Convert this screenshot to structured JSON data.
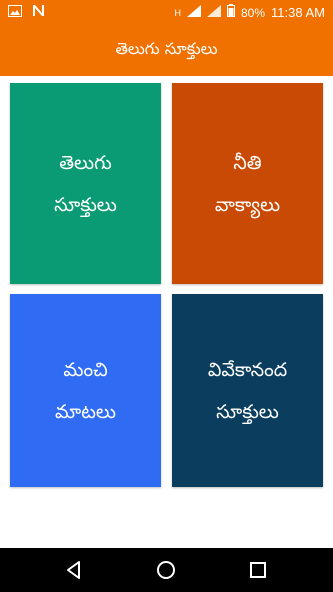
{
  "status_bar": {
    "battery": "80%",
    "time": "11:38 AM",
    "network_label": "H",
    "icons": [
      "image-notification-icon",
      "n-notification-icon",
      "signal-icon",
      "battery-icon"
    ]
  },
  "app_bar": {
    "title": "తెలుగు సూక్తులు"
  },
  "tiles": [
    {
      "line1": "తెలుగు",
      "line2": "సూక్తులు",
      "color": "#0a9b74"
    },
    {
      "line1": "నీతి",
      "line2": "వాక్యాలు",
      "color": "#c94a05"
    },
    {
      "line1": "మంచి",
      "line2": "మాటలు",
      "color": "#2f6cf3"
    },
    {
      "line1": "వివేకానంద",
      "line2": "సూక్తులు",
      "color": "#0a3d5e"
    }
  ],
  "colors": {
    "primary": "#f07000",
    "nav_bar": "#000000"
  },
  "nav": {
    "icons": [
      "back-icon",
      "home-icon",
      "recents-icon"
    ]
  }
}
